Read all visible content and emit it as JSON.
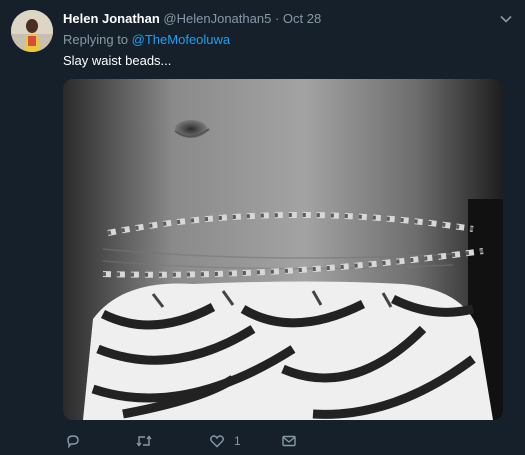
{
  "tweet": {
    "author_name": "Helen Jonathan",
    "author_handle": "@HelenJonathan5",
    "separator": "·",
    "date": "Oct 28",
    "replying_prefix": "Replying to",
    "replying_to": "@TheMofeoluwa",
    "text": "Slay waist beads...",
    "like_count": "1"
  },
  "icons": {
    "more": "chevron-down-icon",
    "reply": "reply-icon",
    "retweet": "retweet-icon",
    "like": "heart-icon",
    "dm": "envelope-icon"
  },
  "colors": {
    "background": "#15202b",
    "secondary_text": "#8899a6",
    "link": "#1da1f2"
  }
}
